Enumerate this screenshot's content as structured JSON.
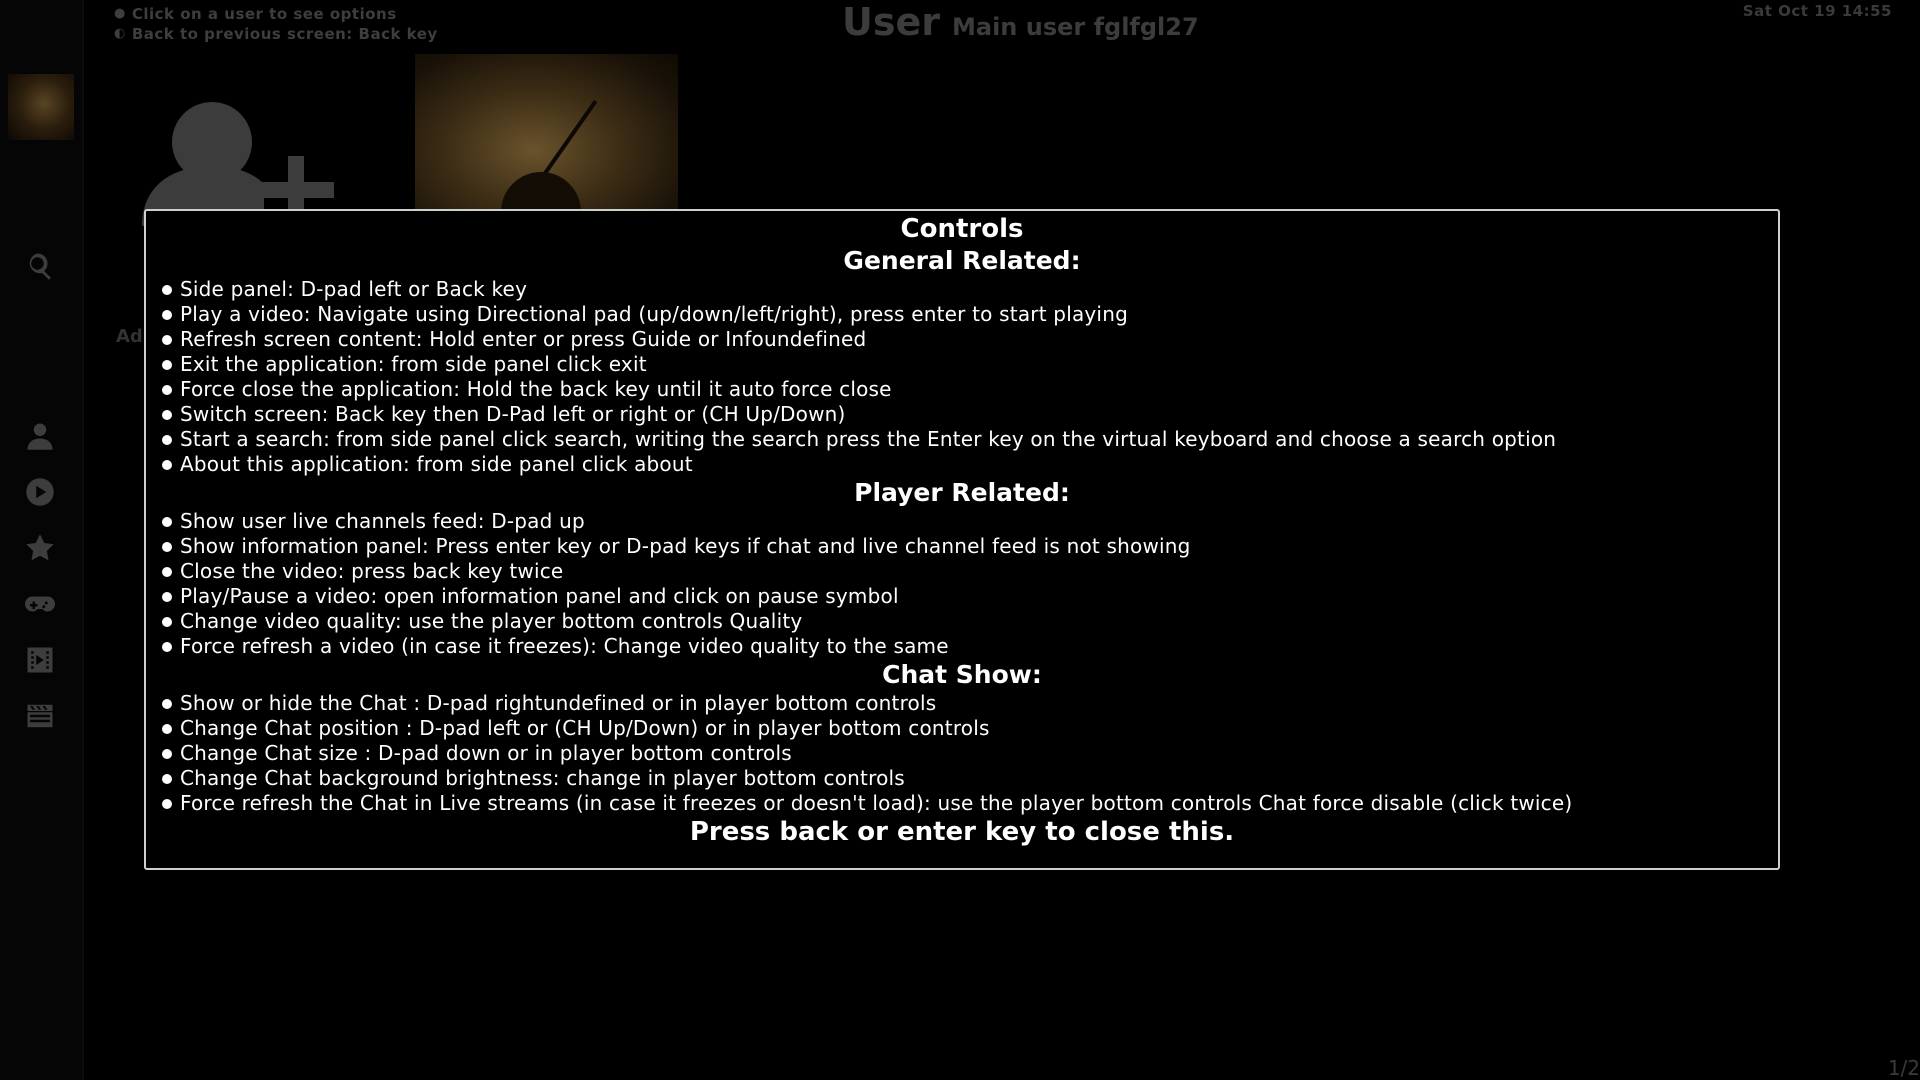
{
  "header": {
    "hints": [
      {
        "icon": "user-icon",
        "text": "Click on a user to see options"
      },
      {
        "icon": "back-circle-icon",
        "text": "Back to previous screen: Back key"
      }
    ],
    "title": "User",
    "subtitle": "Main user fglfgl27",
    "datetime": "Sat Oct 19 14:55"
  },
  "sidebar": {
    "icons": [
      "search-icon",
      "user-icon",
      "play-icon",
      "star-icon",
      "gamepad-icon",
      "video-icon",
      "clapperboard-icon"
    ]
  },
  "tiles": {
    "add_label": "Ad"
  },
  "page_indicator": "1/2",
  "dialog": {
    "title": "Controls",
    "general": {
      "heading": "General Related:",
      "items": [
        "Side panel: D-pad left or Back key",
        "Play a video: Navigate using Directional pad (up/down/left/right), press enter to start playing",
        "Refresh screen content: Hold enter or press Guide or Infoundefined",
        "Exit the application: from side panel click exit",
        "Force close the application: Hold the back key until it auto force close",
        "Switch screen: Back key then D-Pad left or right or (CH Up/Down)",
        "Start a search: from side panel click search, writing the search press the Enter key on the virtual keyboard and choose a search option",
        "About this application: from side panel click about"
      ]
    },
    "player": {
      "heading": "Player Related:",
      "items": [
        "Show user live channels feed: D-pad up",
        "Show information panel: Press enter key or D-pad keys if chat and live channel feed is not showing",
        "Close the video: press back key twice",
        "Play/Pause a video: open information panel and click on pause symbol",
        "Change video quality: use the player bottom controls Quality",
        "Force refresh a video (in case it freezes): Change video quality to the same"
      ]
    },
    "chat": {
      "heading": "Chat Show:",
      "items": [
        "Show or hide the Chat : D-pad rightundefined or in player bottom controls",
        "Change Chat position : D-pad left or (CH Up/Down) or in player bottom controls",
        "Change Chat size : D-pad down or in player bottom controls",
        "Change Chat background brightness: change in player bottom controls",
        "Force refresh the Chat in Live streams (in case it freezes or doesn't load): use the player bottom controls Chat force disable (click twice)"
      ]
    },
    "close_hint": "Press back or enter key to close this."
  }
}
